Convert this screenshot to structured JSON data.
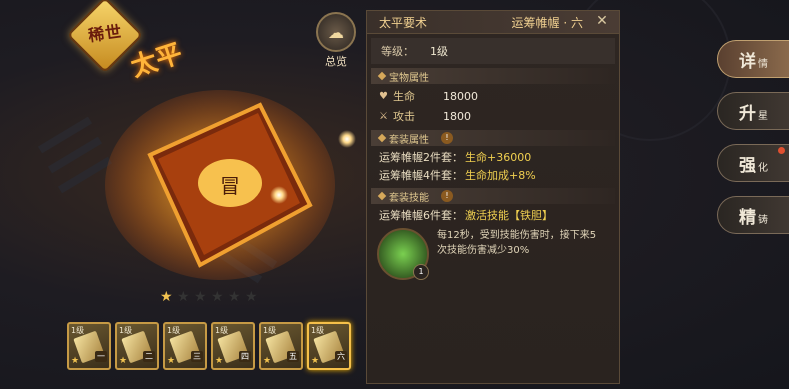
{
  "badge": {
    "text": "稀世"
  },
  "item_art_text": "太平",
  "overview": {
    "label": "总览",
    "icon": "cloud-icon"
  },
  "stars": {
    "total": 6,
    "filled": 1
  },
  "equipment_slots": [
    {
      "level": "1级",
      "tier": "一",
      "stars": 1,
      "selected": false
    },
    {
      "level": "1级",
      "tier": "二",
      "stars": 1,
      "selected": false
    },
    {
      "level": "1级",
      "tier": "三",
      "stars": 1,
      "selected": false
    },
    {
      "level": "1级",
      "tier": "四",
      "stars": 1,
      "selected": false
    },
    {
      "level": "1级",
      "tier": "五",
      "stars": 1,
      "selected": false
    },
    {
      "level": "1级",
      "tier": "六",
      "stars": 1,
      "selected": true
    }
  ],
  "panel": {
    "title": "太平要术",
    "subtitle": "运筹帷幄 · 六",
    "level_label": "等级：",
    "level_value": "1级",
    "treasure_attr_title": "宝物属性",
    "stats": [
      {
        "icon": "heart-icon",
        "label": "生命",
        "value": "18000"
      },
      {
        "icon": "sword-icon",
        "label": "攻击",
        "value": "1800"
      }
    ],
    "set_attr_title": "套装属性",
    "set_bonuses": [
      {
        "name": "运筹帷幄2件套：",
        "effect": "生命+36000"
      },
      {
        "name": "运筹帷幄4件套：",
        "effect": "生命加成+8%"
      }
    ],
    "set_skill_title": "套装技能",
    "skill_line": {
      "name": "运筹帷幄6件套：",
      "effect": "激活技能【铁胆】"
    },
    "skill_desc": "每12秒，受到技能伤害时，接下来5次技能伤害减少30%",
    "skill_level": "1",
    "info_icon": "!"
  },
  "side_tabs": [
    {
      "big": "详",
      "small": "情",
      "active": true,
      "dot": false
    },
    {
      "big": "升",
      "small": "星",
      "active": false,
      "dot": false
    },
    {
      "big": "强",
      "small": "化",
      "active": false,
      "dot": true
    },
    {
      "big": "精",
      "small": "铸",
      "active": false,
      "dot": false
    }
  ]
}
